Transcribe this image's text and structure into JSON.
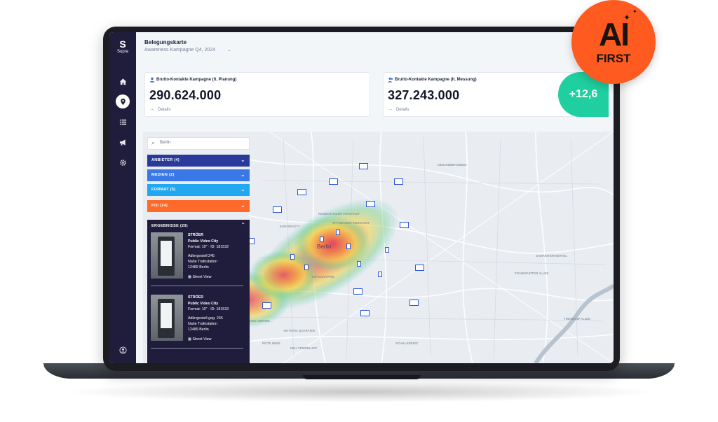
{
  "app": {
    "logo_text": "Supra"
  },
  "header": {
    "title": "Belegungskarte",
    "campaign": "Awareness Kampagne Q4, 2024"
  },
  "kpi": [
    {
      "label": "Brutto-Kontakte Kampagne (lt. Planung)",
      "value": "290.624.000",
      "details": "Details"
    },
    {
      "label": "Brutto-Kontakte Kampagne (lt. Messung)",
      "value": "327.243.000",
      "details": "Details"
    }
  ],
  "delta": "+12,6",
  "search": {
    "placeholder": "Berlin"
  },
  "filters": [
    {
      "label": "ANBIETER (4)",
      "color": "#2a3a9a"
    },
    {
      "label": "MEDIEN (2)",
      "color": "#3a78e8"
    },
    {
      "label": "FORMAT (5)",
      "color": "#22a8f0"
    },
    {
      "label": "POI (24)",
      "color": "#ff6a2a"
    }
  ],
  "results": {
    "header": "ERGEBNISSE (20)",
    "items": [
      {
        "vendor": "STRÖER",
        "product": "Public Video City",
        "format": "Format: 10\" · ID: 181532",
        "address1": "Adlergestell 245",
        "address2": "Nahe Trafostation",
        "address3": "12489 Berlin",
        "street_view": "Street View"
      },
      {
        "vendor": "STRÖER",
        "product": "Public Video City",
        "format": "Format: 10\" · ID: 181533",
        "address1": "Adlergestell geg. 245",
        "address2": "Nahe Trafostation",
        "address3": "12489 Berlin",
        "street_view": "Street View"
      }
    ]
  },
  "map": {
    "city_label": "Berlin",
    "district_labels": [
      "GESUNDBRUNNEN",
      "EUROPACITY",
      "ROSENTHALER VORSTADT",
      "SPANDAUER VORSTADT",
      "BAYERISCHES VIERTEL",
      "VIKTORIA QUARTIER",
      "NEU-TEMPELHOF",
      "FRANKFURTER ALLEE",
      "SAMARITERVIERTEL",
      "SCHILLERKIEZ",
      "TRESKOW-ALLEE",
      "TOPOGRAPHIE",
      "ROTE INSEL"
    ]
  },
  "badge": {
    "main": "AI",
    "sub": "FIRST"
  },
  "colors": {
    "accent": "#3b6be0",
    "sidebar": "#1f1d3b",
    "delta": "#1fcfa0",
    "badge": "#ff5a1f"
  }
}
